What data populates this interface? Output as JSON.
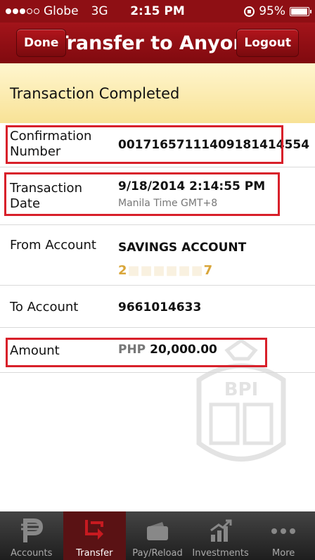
{
  "status_bar": {
    "carrier": "Globe",
    "network": "3G",
    "time": "2:15 PM",
    "battery": "95%",
    "battery_level": 0.95
  },
  "nav": {
    "title": "Transfer to Anyone",
    "done_label": "Done",
    "logout_label": "Logout"
  },
  "banner": {
    "text": "Transaction Completed"
  },
  "rows": {
    "confirmation": {
      "label_line1": "Confirmation",
      "label_line2": "Number",
      "value": "0017165711140918141455 4"
    },
    "date": {
      "label_line1": "Transaction",
      "label_line2": "Date",
      "value": "9/18/2014 2:14:55 PM",
      "sub": "Manila Time GMT+8"
    },
    "from": {
      "label": "From Account",
      "value": "SAVINGS ACCOUNT",
      "account_partial_start": "2",
      "account_partial_end": "7"
    },
    "to": {
      "label": "To Account",
      "value": "9661014633"
    },
    "amount": {
      "label": "Amount",
      "currency": "PHP",
      "value": "20,000.00"
    }
  },
  "watermark_text": "BPI",
  "tabs": [
    {
      "label": "Accounts",
      "icon": "peso-icon"
    },
    {
      "label": "Transfer",
      "icon": "transfer-arrows-icon",
      "active": true
    },
    {
      "label": "Pay/Reload",
      "icon": "wallet-icon"
    },
    {
      "label": "Investments",
      "icon": "chart-growth-icon"
    },
    {
      "label": "More",
      "icon": "more-dots-icon"
    }
  ],
  "colors": {
    "brand_red": "#8e0f14",
    "banner_yellow": "#f8e296",
    "highlight_red": "#d8202a"
  }
}
